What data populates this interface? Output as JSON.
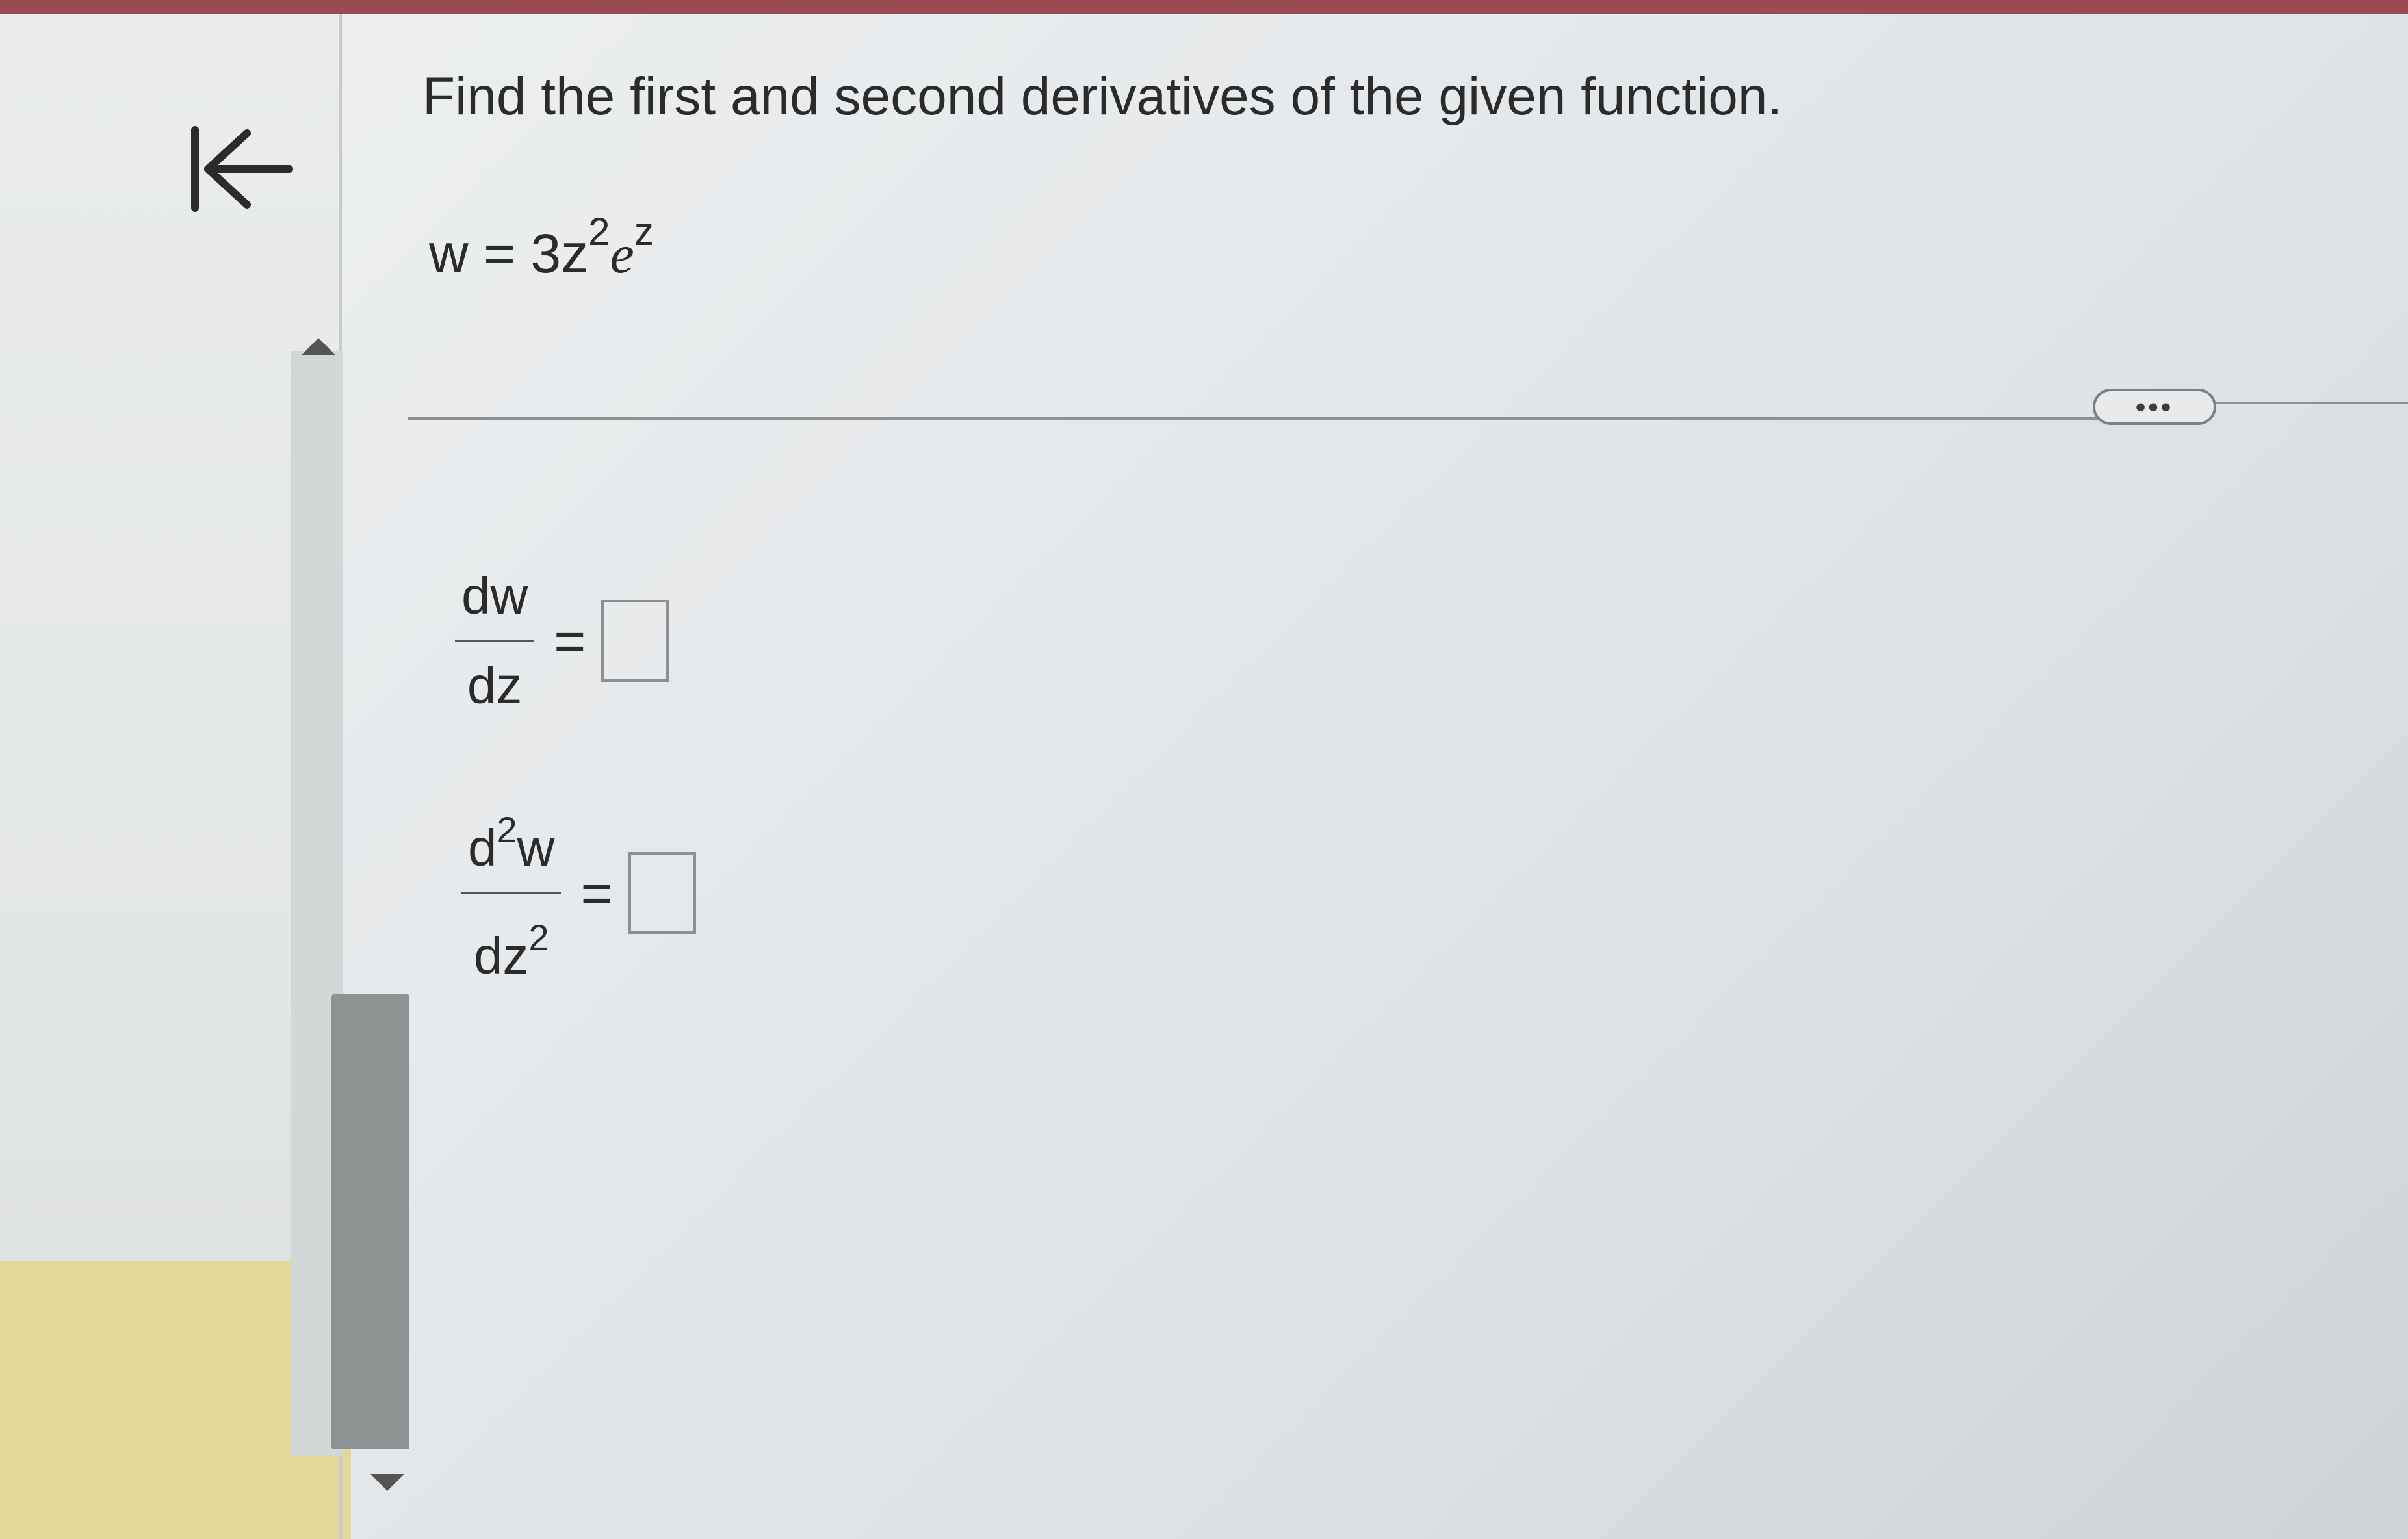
{
  "question": {
    "text": "Find the first and second derivatives of the given function."
  },
  "function": {
    "lhs": "w",
    "equals": "=",
    "coefficient": "3z",
    "power": "2",
    "base": "e",
    "exponent": "z"
  },
  "more_button": {
    "label": "•••"
  },
  "first_derivative": {
    "numerator": "dw",
    "denominator": "dz",
    "equals": "=",
    "answer": ""
  },
  "second_derivative": {
    "numerator_d": "d",
    "numerator_power": "2",
    "numerator_w": "w",
    "denominator_dz": "dz",
    "denominator_power": "2",
    "equals": "=",
    "answer": ""
  },
  "colors": {
    "top_bar": "#9a4a50",
    "text": "#2b2b2b",
    "panel_yellow": "#e3d79a"
  }
}
